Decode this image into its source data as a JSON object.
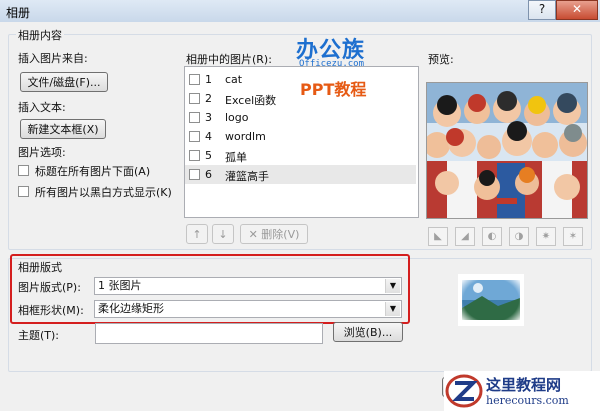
{
  "window": {
    "title": "相册",
    "help_label": "?",
    "close_label": "✕"
  },
  "album_content": {
    "group_label": "相册内容",
    "insert_from_label": "插入图片来自:",
    "file_disk_button": "文件/磁盘(F)...",
    "insert_text_label": "插入文本:",
    "new_textbox_button": "新建文本框(X)",
    "picture_options_label": "图片选项:",
    "option_caption": "标题在所有图片下面(A)",
    "option_bw": "所有图片以黑白方式显示(K)"
  },
  "pictures_list": {
    "label": "相册中的图片(R):",
    "items": [
      {
        "num": "1",
        "name": "cat",
        "checked": false,
        "selected": false
      },
      {
        "num": "2",
        "name": "Excel函数",
        "checked": false,
        "selected": false
      },
      {
        "num": "3",
        "name": "logo",
        "checked": false,
        "selected": false
      },
      {
        "num": "4",
        "name": "wordlm",
        "checked": false,
        "selected": false
      },
      {
        "num": "5",
        "name": "孤单",
        "checked": false,
        "selected": false
      },
      {
        "num": "6",
        "name": "灌篮高手",
        "checked": false,
        "selected": true
      }
    ],
    "move_up_icon": "arrow-up-icon",
    "move_down_icon": "arrow-down-icon",
    "delete_button": "删除(V)"
  },
  "preview": {
    "label": "预览:"
  },
  "layout": {
    "group_label": "相册版式",
    "picture_layout_label": "图片版式(P):",
    "picture_layout_value": "1 张图片",
    "frame_shape_label": "相框形状(M):",
    "frame_shape_value": "柔化边缘矩形",
    "theme_label": "主题(T):",
    "theme_value": "",
    "browse_button": "浏览(B)..."
  },
  "watermarks": {
    "brand_cn": "办公族",
    "brand_url": "Officezu.com",
    "brand_sub": "PPT教程",
    "site_cn": "这里教程网",
    "site_url": "herecours.com"
  },
  "colors": {
    "highlight": "#d41e1e",
    "accent_blue": "#1d6fcf"
  }
}
